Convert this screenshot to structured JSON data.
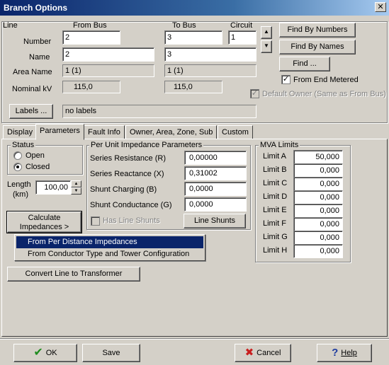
{
  "window": {
    "title": "Branch Options",
    "close": "✕"
  },
  "top": {
    "line_label": "Line",
    "from_bus_header": "From Bus",
    "to_bus_header": "To Bus",
    "circuit_header": "Circuit",
    "number_label": "Number",
    "name_label": "Name",
    "area_name_label": "Area Name",
    "nominal_kv_label": "Nominal kV",
    "from_number": "2",
    "to_number": "3",
    "circuit": "1",
    "from_name": "2",
    "to_name": "3",
    "from_area": "1 (1)",
    "to_area": "1 (1)",
    "from_kv": "115,0",
    "to_kv": "115,0",
    "find_by_numbers": "Find By Numbers",
    "find_by_names": "Find By Names",
    "find": "Find ...",
    "from_end_metered": "From End Metered",
    "from_end_metered_checked": true,
    "default_owner": "Default Owner (Same as From Bus)",
    "labels_button": "Labels ...",
    "labels_value": "no labels"
  },
  "tabs": [
    "Display",
    "Parameters",
    "Fault Info",
    "Owner, Area, Zone, Sub",
    "Custom"
  ],
  "active_tab": "Parameters",
  "status": {
    "title": "Status",
    "open_label": "Open",
    "closed_label": "Closed",
    "selected": "Closed"
  },
  "length": {
    "label_1": "Length",
    "label_2": "(km)",
    "value": "100,00"
  },
  "calculate_button": "Calculate Impedances >",
  "menu": [
    "From Per Distance Impedances",
    "From Conductor Type and Tower Configuration"
  ],
  "pu": {
    "title": "Per Unit Impedance Parameters",
    "series_resistance_label": "Series Resistance (R)",
    "series_resistance": "0,00000",
    "series_reactance_label": "Series Reactance (X)",
    "series_reactance": "0,31002",
    "shunt_charging_label": "Shunt Charging (B)",
    "shunt_charging": "0,0000",
    "shunt_conductance_label": "Shunt Conductance (G)",
    "shunt_conductance": "0,0000",
    "has_line_shunts": "Has Line Shunts",
    "line_shunts_button": "Line Shunts"
  },
  "mva": {
    "title": "MVA Limits",
    "limits": [
      {
        "label": "Limit A",
        "value": "50,000"
      },
      {
        "label": "Limit B",
        "value": "0,000"
      },
      {
        "label": "Limit C",
        "value": "0,000"
      },
      {
        "label": "Limit D",
        "value": "0,000"
      },
      {
        "label": "Limit E",
        "value": "0,000"
      },
      {
        "label": "Limit F",
        "value": "0,000"
      },
      {
        "label": "Limit G",
        "value": "0,000"
      },
      {
        "label": "Limit H",
        "value": "0,000"
      }
    ]
  },
  "convert_button": "Convert Line to Transformer",
  "footer": {
    "ok": "OK",
    "save": "Save",
    "cancel": "Cancel",
    "help": "Help"
  },
  "colors": {
    "title_bar": "#0a246a",
    "ok_check": "#1e8c1e",
    "cancel_x": "#c81e1e",
    "help_q": "#1e3ca0"
  }
}
